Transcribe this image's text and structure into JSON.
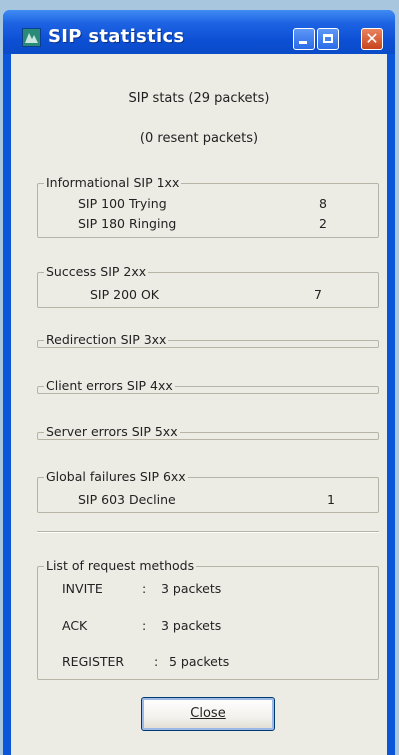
{
  "window": {
    "title": "SIP statistics",
    "buttons": {
      "minimize": "minimize-icon",
      "maximize": "maximize-icon",
      "close": "close-icon"
    }
  },
  "summary": {
    "packets": "SIP stats (29 packets)",
    "resent": "(0 resent packets)"
  },
  "groups": {
    "informational": {
      "label": "Informational  SIP 1xx",
      "rows": [
        {
          "name": "SIP 100 Trying",
          "count": "8"
        },
        {
          "name": "SIP 180 Ringing",
          "count": "2"
        }
      ]
    },
    "success": {
      "label": "Success      SIP 2xx",
      "rows": [
        {
          "name": "SIP 200 OK",
          "count": "7"
        }
      ]
    },
    "redirection": {
      "label": "Redirection    SIP 3xx"
    },
    "client_errors": {
      "label": "Client errors  SIP 4xx"
    },
    "server_errors": {
      "label": "Server errors  SIP 5xx"
    },
    "global_failures": {
      "label": "Global failures  SIP 6xx",
      "rows": [
        {
          "name": "SIP 603 Decline",
          "count": "1"
        }
      ]
    },
    "request_methods": {
      "label": "List of request methods",
      "rows": [
        {
          "method": "INVITE",
          "sep": ":",
          "value": "3 packets"
        },
        {
          "method": "ACK",
          "sep": ":",
          "value": "3 packets"
        },
        {
          "method": "REGISTER",
          "sep": ":",
          "value": "5 packets"
        }
      ]
    }
  },
  "close_button": {
    "label": "Close"
  },
  "colors": {
    "titlebar": "#0d4fd4",
    "client_bg": "#ecebe4",
    "close_button_red": "#c8431d"
  }
}
